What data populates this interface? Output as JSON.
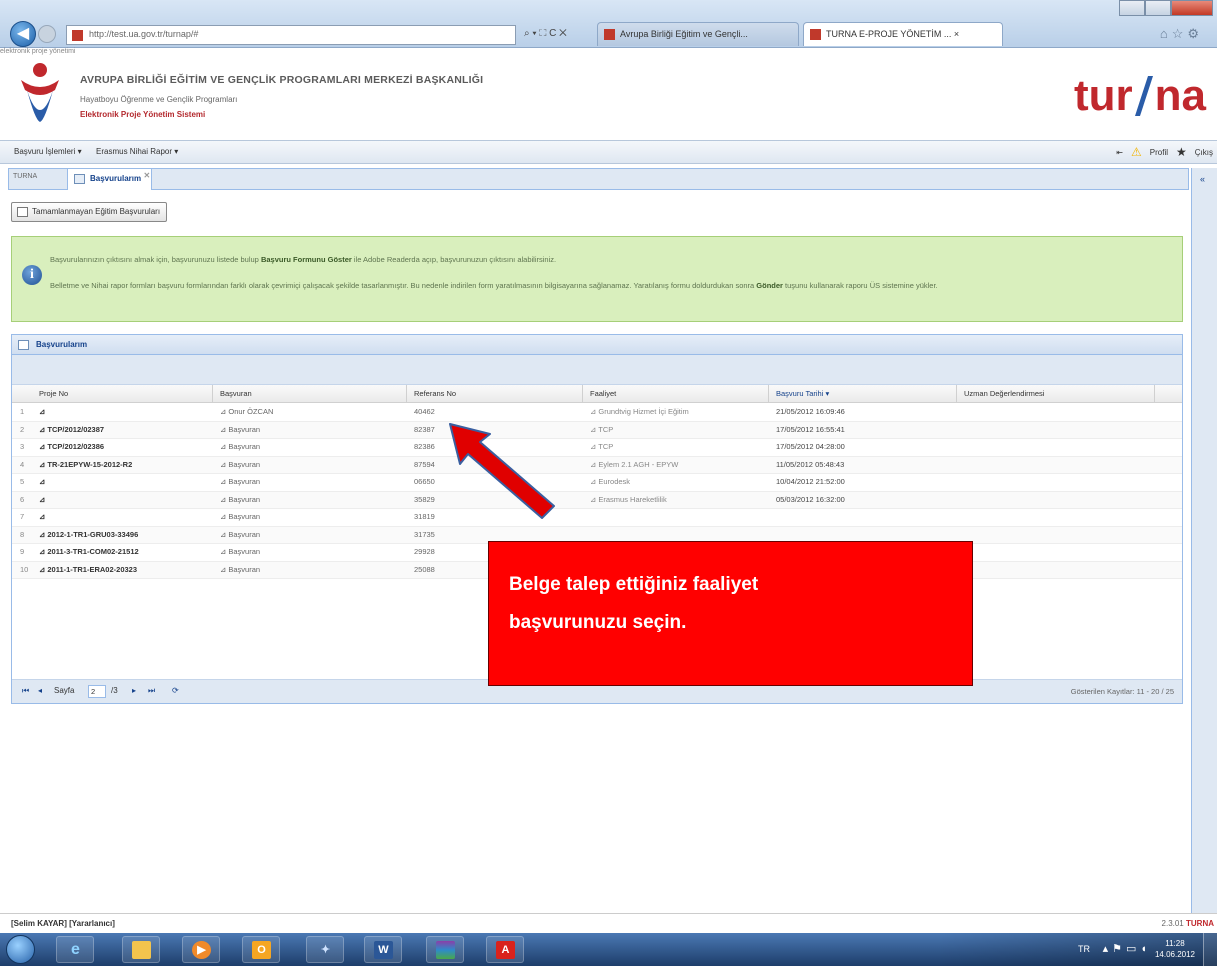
{
  "browser": {
    "address": "http://test.ua.gov.tr/turnap/#",
    "addr_tools": "⌕ ▾ ⛶ C ✕",
    "tabs": [
      {
        "label": "Avrupa Birliği Eğitim ve Gençli..."
      },
      {
        "label": "TURNA E-PROJE YÖNETİM ... ×"
      }
    ],
    "icons": [
      "home-icon",
      "star-icon",
      "gear-icon"
    ]
  },
  "header": {
    "org_title": "AVRUPA BİRLİĞİ EĞİTİM VE GENÇLİK PROGRAMLARI MERKEZİ BAŞKANLIĞI",
    "org_sub1": "Hayatboyu Öğrenme ve Gençlik Programları",
    "org_sub2": "Elektronik Proje Yönetim Sistemi",
    "brand_left": "tur",
    "brand_right": "na",
    "brand_tagline": "elektronik proje yönetimi",
    "brand_color": "#c0282d"
  },
  "menubar": {
    "item1": "Başvuru İşlemleri ▾",
    "item2": "Erasmus Nihai Rapor ▾",
    "right": "Profil",
    "logout": "Çıkış"
  },
  "tabs": {
    "home": "TURNA",
    "active": "Başvurularım",
    "close": "✕"
  },
  "buttons": {
    "incomplete": "Tamamlanmayan Eğitim Başvuruları"
  },
  "info": {
    "line1": "Başvurularınızın çıktısını almak için, başvurunuzu listede bulup ",
    "line1_bold": "Başvuru Formunu Göster",
    "line1_end": " ile Adobe Readerda açıp, başvurunuzun çıktısını alabilirsiniz.",
    "line2": "Belletme ve Nihai rapor formları başvuru formlarından farklı olarak çevrimiçi çalışacak şekilde tasarlanmıştır. Bu nedenle indirilen form yaratılmasının bilgisayarına sağlanamaz. Yaratılanış formu doldurdukan sonra ",
    "line2_bold": "Gönder",
    "line2_end": " tuşunu kullanarak raporu ÜS sistemine yükler.",
    "info_color": "#d9efbd"
  },
  "grid": {
    "title": "Başvurularım",
    "columns": [
      "Proje No",
      "Başvuran",
      "Referans No",
      "Faaliyet",
      "Başvuru Tarihi ▾",
      "Uzman Değerlendirmesi"
    ],
    "rows": [
      {
        "idx": "1",
        "proje": "⊿",
        "basvuran": "⊿ Onur ÖZCAN",
        "ref": "40462",
        "faaliyet": "⊿ Grundtvig Hizmet İçi Eğitim",
        "tarih": "21/05/2012 16:09:46"
      },
      {
        "idx": "2",
        "proje": "⊿ TCP/2012/02387",
        "basvuran": "⊿ Başvuran",
        "ref": "82387",
        "faaliyet": "⊿ TCP",
        "tarih": "17/05/2012 16:55:41"
      },
      {
        "idx": "3",
        "proje": "⊿ TCP/2012/02386",
        "basvuran": "⊿ Başvuran",
        "ref": "82386",
        "faaliyet": "⊿ TCP",
        "tarih": "17/05/2012 04:28:00"
      },
      {
        "idx": "4",
        "proje": "⊿ TR-21EPYW-15-2012-R2",
        "basvuran": "⊿ Başvuran",
        "ref": "87594",
        "faaliyet": "⊿ Eylem 2.1 AGH - EPYW",
        "tarih": "11/05/2012 05:48:43"
      },
      {
        "idx": "5",
        "proje": "⊿",
        "basvuran": "⊿ Başvuran",
        "ref": "06650",
        "faaliyet": "⊿ Eurodesk",
        "tarih": "10/04/2012 21:52:00"
      },
      {
        "idx": "6",
        "proje": "⊿",
        "basvuran": "⊿ Başvuran",
        "ref": "35829",
        "faaliyet": "⊿ Erasmus Hareketlilik",
        "tarih": "05/03/2012 16:32:00"
      },
      {
        "idx": "7",
        "proje": "⊿",
        "basvuran": "⊿ Başvuran",
        "ref": "31819",
        "faaliyet": "",
        "tarih": ""
      },
      {
        "idx": "8",
        "proje": "⊿ 2012-1-TR1-GRU03-33496",
        "basvuran": "⊿ Başvuran",
        "ref": "31735",
        "faaliyet": "",
        "tarih": ""
      },
      {
        "idx": "9",
        "proje": "⊿ 2011-3-TR1-COM02-21512",
        "basvuran": "⊿ Başvuran",
        "ref": "29928",
        "faaliyet": "",
        "tarih": ""
      },
      {
        "idx": "10",
        "proje": "⊿ 2011-1-TR1-ERA02-20323",
        "basvuran": "⊿ Başvuran",
        "ref": "25088",
        "faaliyet": "",
        "tarih": ""
      }
    ]
  },
  "pager": {
    "first": "⏮",
    "prev": "◂",
    "label": "Sayfa",
    "page": "2",
    "of": "/3",
    "next": "▸",
    "last": "⏭",
    "refresh": "⟳",
    "info": "Gösterilen Kayıtlar: 11 - 20 / 25"
  },
  "callout": {
    "line1": "Belge talep ettiğiniz faaliyet",
    "line2": "başvurunuzu seçin.",
    "color": "#ff0000"
  },
  "status": {
    "user": "[Selim KAYAR] [Yararlanıcı]",
    "version": "2.3.01",
    "app": "TURNA"
  },
  "taskbar": {
    "apps": [
      "ie",
      "explorer",
      "media-player",
      "outlook",
      "app",
      "word",
      "winrar",
      "acrobat"
    ],
    "lang": "TR",
    "time": "11:28",
    "date": "14.06.2012"
  }
}
